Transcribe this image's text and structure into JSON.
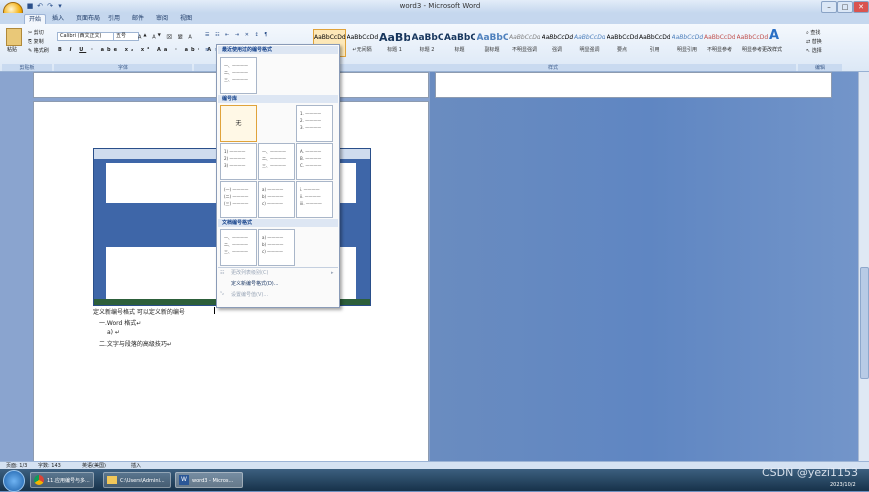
{
  "window": {
    "title": "word3 - Microsoft Word"
  },
  "tabs": [
    "开始",
    "插入",
    "页面布局",
    "引用",
    "邮件",
    "审阅",
    "视图"
  ],
  "clipboard": {
    "paste": "粘贴",
    "cut": "剪切",
    "copy": "复制",
    "format_painter": "格式刷",
    "group": "剪贴板"
  },
  "font": {
    "name": "Calibri (西文正文)",
    "size": "五号",
    "group": "字体"
  },
  "paragraph": {
    "group": "段落"
  },
  "styles": {
    "group": "样式",
    "items": [
      {
        "preview": "AaBbCcDd",
        "name": ""
      },
      {
        "preview": "AaBbCcDd",
        "name": "↵无间隔"
      },
      {
        "preview": "AaBb",
        "name": "标题 1"
      },
      {
        "preview": "AaBbC",
        "name": "标题 2"
      },
      {
        "preview": "AaBbC",
        "name": "标题"
      },
      {
        "preview": "AaBbC",
        "name": "副标题"
      },
      {
        "preview": "AaBbCcDd",
        "name": "不明显强调"
      },
      {
        "preview": "AaBbCcDd",
        "name": "强调"
      },
      {
        "preview": "AaBbCcDd",
        "name": "明显强调"
      },
      {
        "preview": "AaBbCcDd",
        "name": "要点"
      },
      {
        "preview": "AaBbCcDd",
        "name": "引用"
      },
      {
        "preview": "AaBbCcDd",
        "name": "明显引用"
      },
      {
        "preview": "AaBbCcDd",
        "name": "不明显参考"
      },
      {
        "preview": "AaBbCcDd",
        "name": "明显参考"
      }
    ],
    "change_styles": "更改样式"
  },
  "editing": {
    "find": "查找",
    "replace": "替换",
    "select": "选择",
    "group": "编辑"
  },
  "numbering_menu": {
    "recent_header": "最近使用过的编号格式",
    "library_header": "编号库",
    "none_label": "无",
    "doc_header": "文档编号格式",
    "recent": [
      "一、————",
      "二、————",
      "三、————"
    ],
    "library": [
      [
        "1. ————",
        "2. ————",
        "3. ————"
      ],
      [
        "1) ————",
        "2) ————",
        "3) ————"
      ],
      [
        "一、————",
        "二、————",
        "三、————"
      ],
      [
        "A. ————",
        "B. ————",
        "C. ————"
      ],
      [
        "(一) ————",
        "(二) ————",
        "(三) ————"
      ],
      [
        "a) ————",
        "b) ————",
        "c) ————"
      ],
      [
        "i. ————",
        "ii. ————",
        "iii. ————"
      ]
    ],
    "document": [
      [
        "一、————",
        "二、————",
        "三、————"
      ],
      [
        "a) ————",
        "b) ————",
        "c) ————"
      ]
    ],
    "change_level": "更改列表级别(C)",
    "define_new": "定义新编号格式(D)...",
    "set_value": "设置编号值(V)..."
  },
  "document": {
    "line1": "定义新编号格式    可以定义新的编号",
    "line2": "一.Word 格式↵",
    "line3": "a)    ↵",
    "line4": "二.文字与段落的高级技巧↵"
  },
  "statusbar": {
    "page": "页面: 1/3",
    "words": "字数: 143",
    "language": "英语(美国)",
    "mode": "插入"
  },
  "taskbar": {
    "items": [
      "11.应用编号与多...",
      "C:\\Users\\Admini...",
      "word3 - Micros..."
    ],
    "watermark": "CSDN @yezi1153",
    "time": "2023/10/2"
  }
}
